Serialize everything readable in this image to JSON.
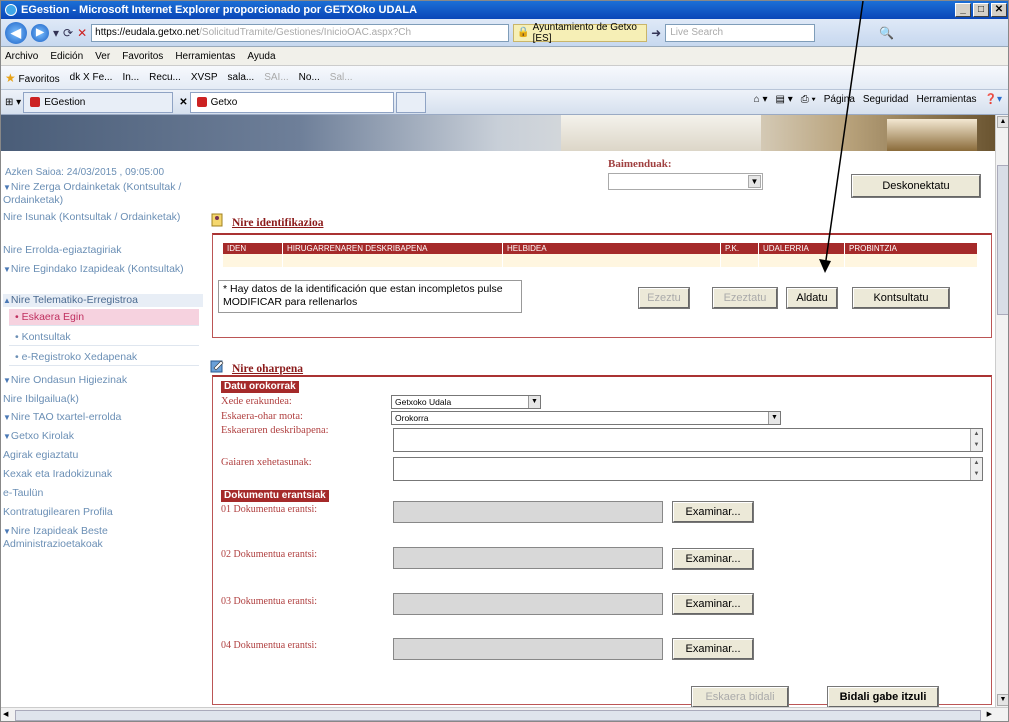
{
  "window": {
    "title": "EGestion - Microsoft Internet Explorer proporcionado por GETXOko UDALA"
  },
  "address": {
    "url_host": "https://eudala.getxo.net",
    "url_path": "/SolicitudTramite/Gestiones/InicioOAC.aspx?Ch",
    "cert": "Ayuntamiento de Getxo [ES]",
    "search_placeholder": "Live Search"
  },
  "menu": [
    "Archivo",
    "Edición",
    "Ver",
    "Favoritos",
    "Herramientas",
    "Ayuda"
  ],
  "favorites": {
    "label": "Favoritos",
    "items": [
      "dk X Fe...",
      "In...",
      "Recu...",
      "XVSP",
      "sala...",
      "SAI...",
      "No...",
      "Sal..."
    ]
  },
  "tabs": [
    "EGestion",
    "Getxo"
  ],
  "cmdbar": [
    "Página",
    "Seguridad",
    "Herramientas"
  ],
  "sidebar": {
    "session": "Azken Saioa: 24/03/2015 , 09:05:00",
    "items": [
      {
        "label": "Nire Zerga Ordainketak (Kontsultak / Ordainketak)",
        "arrow": "▼"
      },
      {
        "label": "Nire Isunak (Kontsultak / Ordainketak)",
        "arrow": ""
      },
      {
        "label": "Nire Errolda-egiaztagiriak",
        "arrow": ""
      },
      {
        "label": "Nire Egindako Izapideak (Kontsultak)",
        "arrow": "▼"
      },
      {
        "label": "Nire Telematiko-Erregistroa",
        "arrow": "▲"
      },
      {
        "label": "Nire Ondasun Higiezinak",
        "arrow": "▼"
      },
      {
        "label": "Nire Ibilgailua(k)",
        "arrow": ""
      },
      {
        "label": "Nire TAO txartel-erroldа",
        "arrow": "▼"
      },
      {
        "label": "Getxo Kirolak",
        "arrow": "▼"
      },
      {
        "label": "Agirak egiaztatu",
        "arrow": ""
      },
      {
        "label": "Kexak eta Iradokizunak",
        "arrow": ""
      },
      {
        "label": "e-Taulün",
        "arrow": ""
      },
      {
        "label": "Kontratugilearen Profila",
        "arrow": ""
      },
      {
        "label": "Nire Izapideak Beste Administrazioetakoak",
        "arrow": "▼"
      }
    ],
    "subitems": [
      "• Eskaera Egin",
      "• Kontsultak",
      "• e-Registroko Xedapenak"
    ]
  },
  "header": {
    "permissions_label": "Baimenduak:",
    "disconnect_button": "Deskonektatu"
  },
  "identification": {
    "title": "Nire identifikazioa",
    "columns": [
      "IDEN",
      "HIRUGARRENAREN DESKRIBAPENA",
      "HELBIDEA",
      "P.K.",
      "UDALERRIA",
      "PROBINTZIA"
    ],
    "notice": "* Hay datos de la identificación que estan incompletos pulse MODIFICAR para rellenarlos",
    "buttons": {
      "ezeztatu1": "Ezeztu",
      "ezeztatu2": "Ezeztatu",
      "aldatu": "Aldatu",
      "kontsultatu": "Kontsultatu"
    }
  },
  "submission": {
    "title": "Nire oharpena",
    "general_tag": "Datu orokorrak",
    "xede_label": "Xede erakundea:",
    "xede_value": "Getxoko Udala",
    "type_label": "Eskaera-ohar mota:",
    "type_value": "Orokorra",
    "desc_label": "Eskaeraren deskribapena:",
    "notes_label": "Gaiaren xehetasunak:",
    "docs_tag": "Dokumentu erantsiak",
    "documents": [
      "01 Dokumentua erantsi:",
      "02 Dokumentua erantsi:",
      "03 Dokumentua erantsi:",
      "04 Dokumentua erantsi:"
    ],
    "browse_label": "Examinar...",
    "send_button": "Eskaera bidali",
    "back_button": "Bidali gabe itzuli"
  }
}
